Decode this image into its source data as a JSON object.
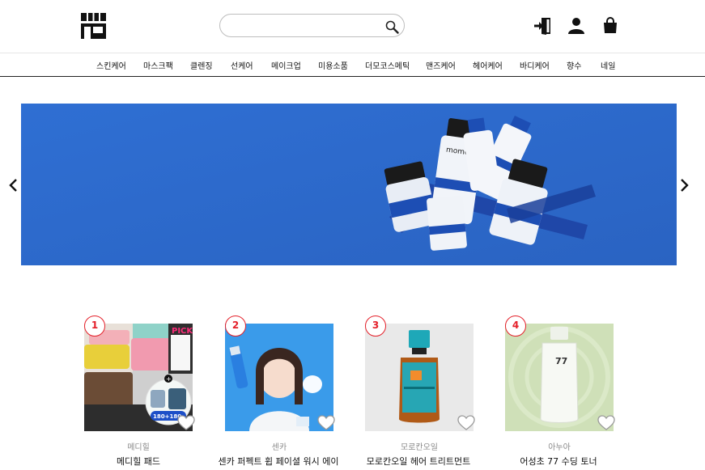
{
  "header": {
    "logo_icon": "store-icon",
    "search": {
      "value": "",
      "placeholder": "",
      "icon": "search-icon"
    },
    "icons": [
      "login-icon",
      "user-icon",
      "shopping-bag-icon"
    ]
  },
  "nav": {
    "items": [
      {
        "label": "스킨케어"
      },
      {
        "label": "마스크팩"
      },
      {
        "label": "클렌징"
      },
      {
        "label": "선케어"
      },
      {
        "label": "메이크업"
      },
      {
        "label": "미용소품"
      },
      {
        "label": "더모코스메틱"
      },
      {
        "label": "맨즈케어"
      },
      {
        "label": "헤어케어"
      },
      {
        "label": "바디케어"
      },
      {
        "label": "향수"
      },
      {
        "label": "네일"
      }
    ]
  },
  "banner": {
    "colors": {
      "background": "#2e6dd0"
    },
    "prev_icon": "chevron-left-icon",
    "next_icon": "chevron-right-icon",
    "product_text": "momentum"
  },
  "products": [
    {
      "rank": "1",
      "brand": "메디힐",
      "name": "메디힐 패드",
      "sticker": "PICK",
      "promo": "180+180"
    },
    {
      "rank": "2",
      "brand": "센카",
      "name": "센카 퍼펙트 휩 페이셜 워시 에이"
    },
    {
      "rank": "3",
      "brand": "모로칸오일",
      "name": "모로칸오일 헤어 트리트먼트"
    },
    {
      "rank": "4",
      "brand": "아누아",
      "name": "어성초 77 수딩 토너",
      "label_number": "77"
    }
  ],
  "colors": {
    "rank_accent": "#e4202a",
    "nav_border": "#222222"
  }
}
